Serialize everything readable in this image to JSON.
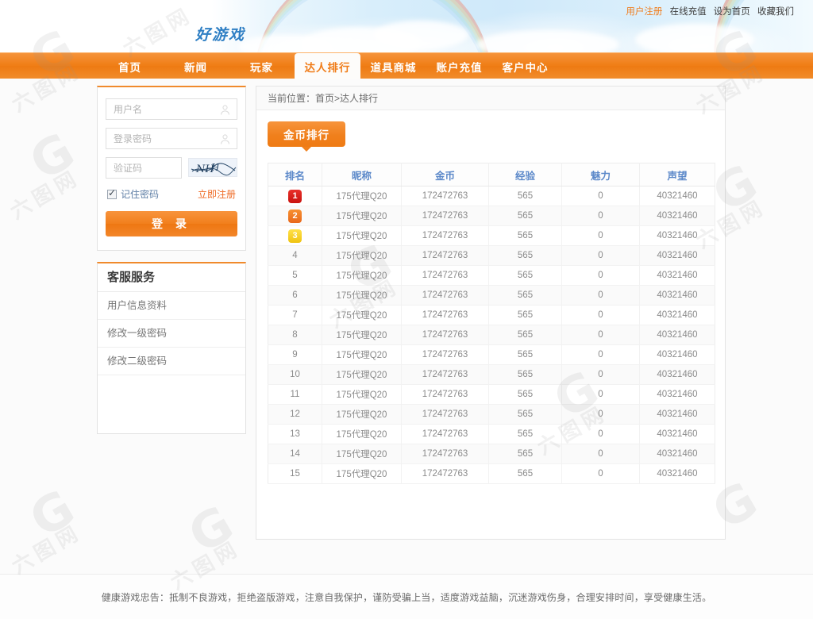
{
  "header": {
    "logo_text": "好游戏",
    "top_links": [
      {
        "label": "用户注册",
        "accent": true
      },
      {
        "label": "在线充值",
        "accent": false
      },
      {
        "label": "设为首页",
        "accent": false
      },
      {
        "label": "收藏我们",
        "accent": false
      }
    ]
  },
  "nav": {
    "items": [
      {
        "label": "首页",
        "active": false
      },
      {
        "label": "新闻",
        "active": false
      },
      {
        "label": "玩家",
        "active": false
      },
      {
        "label": "达人排行",
        "active": true
      },
      {
        "label": "道具商城",
        "active": false
      },
      {
        "label": "账户充值",
        "active": false
      },
      {
        "label": "客户中心",
        "active": false
      }
    ]
  },
  "login": {
    "username_placeholder": "用户名",
    "username_value": "",
    "password_placeholder": "登录密码",
    "password_value": "",
    "captcha_placeholder": "验证码",
    "captcha_value": "",
    "captcha_image_alt": "captcha-image",
    "remember_label": "记住密码",
    "remember_checked": true,
    "register_label": "立即注册",
    "submit_label": "登 录"
  },
  "service": {
    "title": "客服服务",
    "items": [
      {
        "label": "用户信息资料"
      },
      {
        "label": "修改一级密码"
      },
      {
        "label": "修改二级密码"
      }
    ]
  },
  "main": {
    "breadcrumb": "当前位置：首页>达人排行",
    "tabs": [
      {
        "label": "金币排行",
        "active": true
      }
    ]
  },
  "table": {
    "columns": [
      "排名",
      "昵称",
      "金币",
      "经验",
      "魅力",
      "声望"
    ],
    "rows": [
      {
        "rank": "1",
        "badge": "gold-1",
        "nickname": "175代理Q20",
        "coins": "172472763",
        "exp": "565",
        "charm": "0",
        "prestige": "40321460"
      },
      {
        "rank": "2",
        "badge": "gold-2",
        "nickname": "175代理Q20",
        "coins": "172472763",
        "exp": "565",
        "charm": "0",
        "prestige": "40321460"
      },
      {
        "rank": "3",
        "badge": "gold-3",
        "nickname": "175代理Q20",
        "coins": "172472763",
        "exp": "565",
        "charm": "0",
        "prestige": "40321460"
      },
      {
        "rank": "4",
        "badge": "",
        "nickname": "175代理Q20",
        "coins": "172472763",
        "exp": "565",
        "charm": "0",
        "prestige": "40321460"
      },
      {
        "rank": "5",
        "badge": "",
        "nickname": "175代理Q20",
        "coins": "172472763",
        "exp": "565",
        "charm": "0",
        "prestige": "40321460"
      },
      {
        "rank": "6",
        "badge": "",
        "nickname": "175代理Q20",
        "coins": "172472763",
        "exp": "565",
        "charm": "0",
        "prestige": "40321460"
      },
      {
        "rank": "7",
        "badge": "",
        "nickname": "175代理Q20",
        "coins": "172472763",
        "exp": "565",
        "charm": "0",
        "prestige": "40321460"
      },
      {
        "rank": "8",
        "badge": "",
        "nickname": "175代理Q20",
        "coins": "172472763",
        "exp": "565",
        "charm": "0",
        "prestige": "40321460"
      },
      {
        "rank": "9",
        "badge": "",
        "nickname": "175代理Q20",
        "coins": "172472763",
        "exp": "565",
        "charm": "0",
        "prestige": "40321460"
      },
      {
        "rank": "10",
        "badge": "",
        "nickname": "175代理Q20",
        "coins": "172472763",
        "exp": "565",
        "charm": "0",
        "prestige": "40321460"
      },
      {
        "rank": "11",
        "badge": "",
        "nickname": "175代理Q20",
        "coins": "172472763",
        "exp": "565",
        "charm": "0",
        "prestige": "40321460"
      },
      {
        "rank": "12",
        "badge": "",
        "nickname": "175代理Q20",
        "coins": "172472763",
        "exp": "565",
        "charm": "0",
        "prestige": "40321460"
      },
      {
        "rank": "13",
        "badge": "",
        "nickname": "175代理Q20",
        "coins": "172472763",
        "exp": "565",
        "charm": "0",
        "prestige": "40321460"
      },
      {
        "rank": "14",
        "badge": "",
        "nickname": "175代理Q20",
        "coins": "172472763",
        "exp": "565",
        "charm": "0",
        "prestige": "40321460"
      },
      {
        "rank": "15",
        "badge": "",
        "nickname": "175代理Q20",
        "coins": "172472763",
        "exp": "565",
        "charm": "0",
        "prestige": "40321460"
      }
    ]
  },
  "footer": {
    "text": "健康游戏忠告：抵制不良游戏，拒绝盗版游戏，注意自我保护，谨防受骗上当，适度游戏益脑，沉迷游戏伤身，合理安排时间，享受健康生活。"
  },
  "colors": {
    "accent_orange": "#ef7b14",
    "header_blue": "#5b88c9",
    "rank1_red": "#d61f1a",
    "rank2_orange": "#ee7b1f",
    "rank3_yellow": "#f5cf21"
  },
  "watermark": {
    "text": "六图网",
    "mark": "G"
  }
}
